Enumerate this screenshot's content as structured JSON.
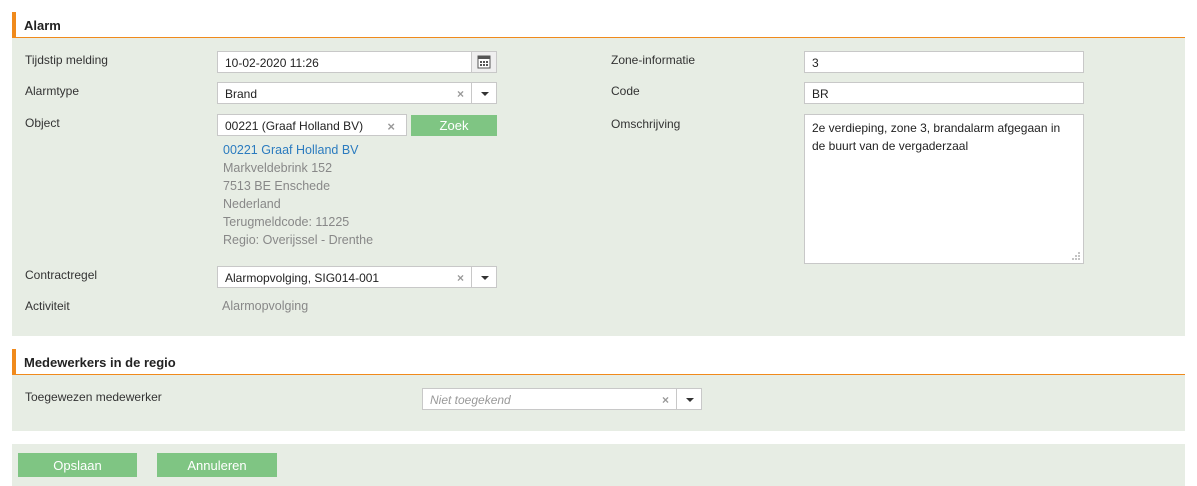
{
  "alarm": {
    "section_title": "Alarm",
    "fields": {
      "tijdstip_label": "Tijdstip melding",
      "tijdstip_value": "10-02-2020 11:26",
      "alarmtype_label": "Alarmtype",
      "alarmtype_value": "Brand",
      "object_label": "Object",
      "object_value": "00221 (Graaf Holland BV)",
      "zoek_button": "Zoek",
      "object_details": {
        "name_link": "00221 Graaf Holland BV",
        "street": "Markveldebrink 152",
        "postal_city": "7513 BE Enschede",
        "country": "Nederland",
        "terugmeldcode": "Terugmeldcode: 11225",
        "regio": "Regio: Overijssel - Drenthe"
      },
      "contractregel_label": "Contractregel",
      "contractregel_value": "Alarmopvolging, SIG014-001",
      "activiteit_label": "Activiteit",
      "activiteit_value": "Alarmopvolging",
      "zone_label": "Zone-informatie",
      "zone_value": "3",
      "code_label": "Code",
      "code_value": "BR",
      "omschrijving_label": "Omschrijving",
      "omschrijving_value": "2e verdieping, zone 3, brandalarm afgegaan in de buurt van de vergaderzaal"
    }
  },
  "medewerkers": {
    "section_title": "Medewerkers in de regio",
    "toegewezen_label": "Toegewezen medewerker",
    "toegewezen_placeholder": "Niet toegekend"
  },
  "footer": {
    "save_label": "Opslaan",
    "cancel_label": "Annuleren"
  },
  "colors": {
    "accent": "#f08a1c",
    "panel_bg": "#e7ede4",
    "button_green": "#7fc583",
    "link": "#2b7bbf"
  },
  "icons": [
    "calendar-icon",
    "clear-icon",
    "chevron-down-icon",
    "resize-grip-icon"
  ]
}
